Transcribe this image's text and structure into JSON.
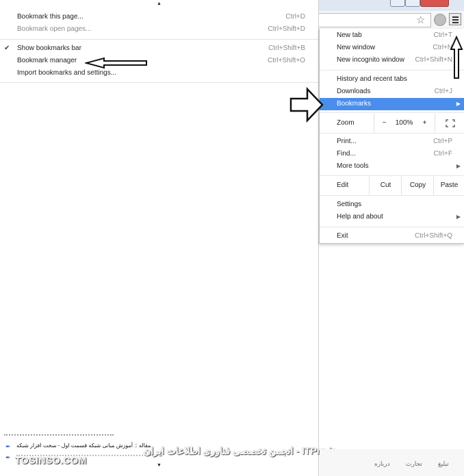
{
  "bookmarks_submenu": {
    "items": [
      {
        "label": "Bookmark this page...",
        "shortcut": "Ctrl+D"
      },
      {
        "label": "Bookmark open pages...",
        "shortcut": "Ctrl+Shift+D"
      },
      {
        "label": "Show bookmarks bar",
        "shortcut": "Ctrl+Shift+B",
        "checked": true
      },
      {
        "label": "Bookmark manager",
        "shortcut": "Ctrl+Shift+O"
      },
      {
        "label": "Import bookmarks and settings..."
      }
    ]
  },
  "chrome_menu": {
    "new_tab": {
      "label": "New tab",
      "shortcut": "Ctrl+T"
    },
    "new_window": {
      "label": "New window",
      "shortcut": "Ctrl+N"
    },
    "new_incognito": {
      "label": "New incognito window",
      "shortcut": "Ctrl+Shift+N"
    },
    "history": {
      "label": "History and recent tabs"
    },
    "downloads": {
      "label": "Downloads",
      "shortcut": "Ctrl+J"
    },
    "bookmarks": {
      "label": "Bookmarks"
    },
    "zoom": {
      "label": "Zoom",
      "minus": "−",
      "value": "100%",
      "plus": "+"
    },
    "print": {
      "label": "Print...",
      "shortcut": "Ctrl+P"
    },
    "find": {
      "label": "Find...",
      "shortcut": "Ctrl+F"
    },
    "more_tools": {
      "label": "More tools"
    },
    "edit": {
      "label": "Edit",
      "cut": "Cut",
      "copy": "Copy",
      "paste": "Paste"
    },
    "settings": {
      "label": "Settings"
    },
    "help": {
      "label": "Help and about"
    },
    "exit": {
      "label": "Exit",
      "shortcut": "Ctrl+Shift+Q"
    }
  },
  "page_bottom": {
    "link1": "مقاله :: آموزش مبانی شبکه قسمت اول - سخت افزار شبکه",
    "watermark_left": "TOSINSO.COM",
    "watermark_right": "ITPro.ir - انجمن تخصصی فناوری اطلاعات ایران",
    "footer_links": [
      "تبلیغ",
      "تجارت",
      "درباره"
    ]
  },
  "colors": {
    "highlight": "#4a8ded"
  },
  "icons": [
    "check-icon",
    "star-icon",
    "globe-icon",
    "hamburger-menu-icon",
    "submenu-arrow-icon",
    "annotation-arrow-icon"
  ]
}
